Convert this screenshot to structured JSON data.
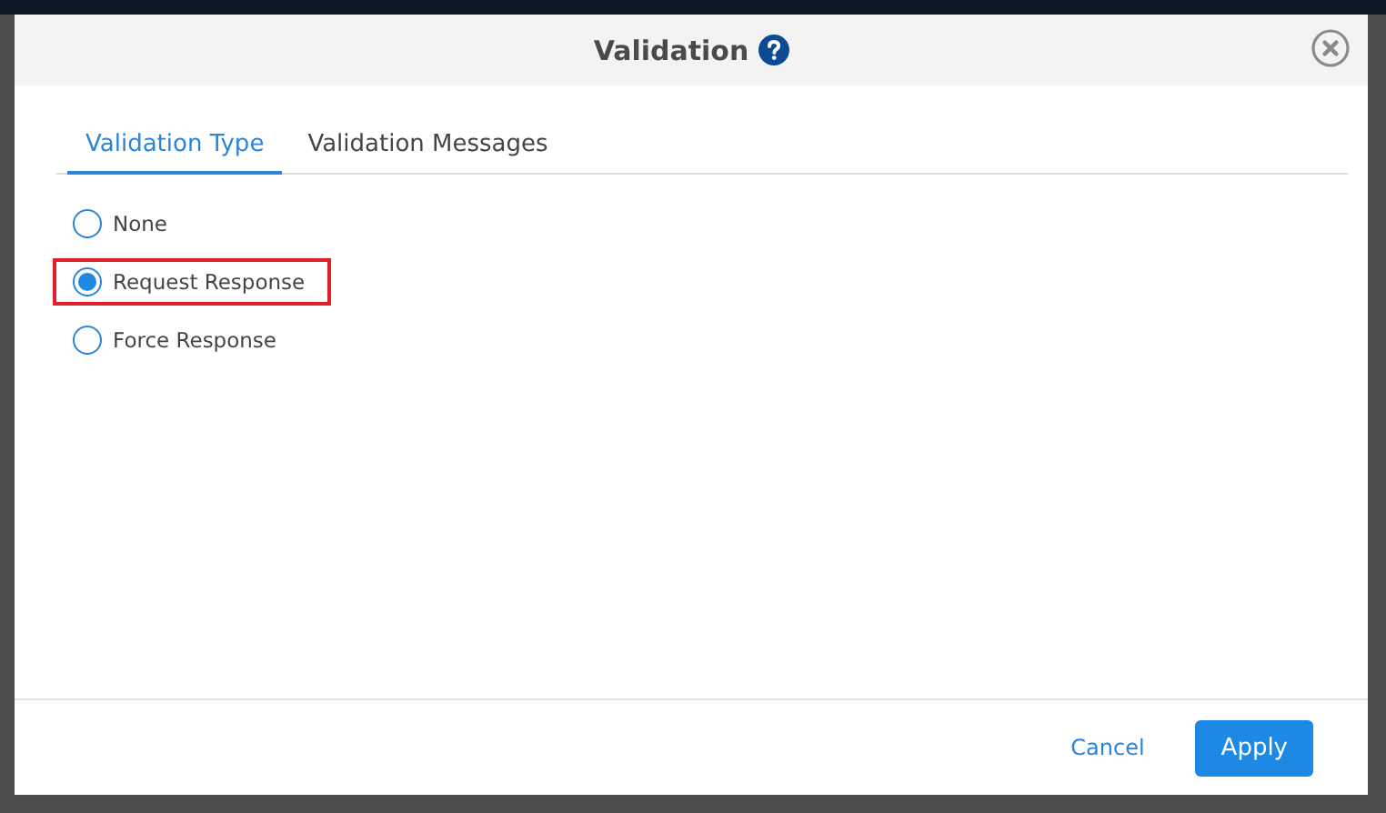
{
  "dialog": {
    "title": "Validation",
    "tabs": [
      {
        "label": "Validation Type",
        "selected": true
      },
      {
        "label": "Validation Messages",
        "selected": false
      }
    ],
    "options": [
      {
        "label": "None",
        "selected": false,
        "highlighted": false
      },
      {
        "label": "Request Response",
        "selected": true,
        "highlighted": true
      },
      {
        "label": "Force Response",
        "selected": false,
        "highlighted": false
      }
    ],
    "buttons": [
      {
        "label": "Cancel",
        "kind": "link"
      },
      {
        "label": "Apply",
        "kind": "primary"
      }
    ]
  }
}
